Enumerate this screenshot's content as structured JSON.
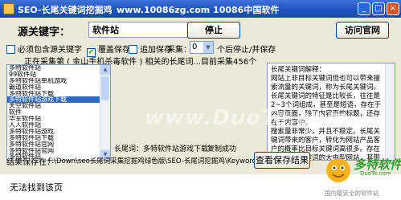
{
  "window": {
    "title": "SEO-长尾关键词挖掘鸡",
    "site_text": "www.10086zg.com  10086中国软件",
    "minimize_glyph": "_",
    "maximize_glyph": "□",
    "close_glyph": "×"
  },
  "form": {
    "keyword_label": "源关键字：",
    "keyword_value": "软件站",
    "stop_button": "停止",
    "home_button": "访问官网",
    "option_include": "必须包含源关键字",
    "option_overwrite": "覆盖保存",
    "option_append": "追加保存",
    "collect_label": "采集：",
    "collect_value": "0",
    "pause_text": "个后停止/并保存",
    "status_text": "正在采集第 ( 金山手机杀毒软件 ) 相关的长尾词...目前采集456个"
  },
  "results": {
    "items": [
      "多特软件站",
      "99软件站",
      "多特软件站单机游戏",
      "霸道软件站",
      "多特软件站下载",
      "多特软件站游戏下载",
      "天空软件站",
      "软件",
      "华军软件站",
      "人人软件站",
      "多特软件站游戏",
      "多特软件站下载",
      "多特软件站官网",
      "多特软件站官网",
      "多特软件站"
    ],
    "selected_index": 5,
    "longtail_label": "长尾词：多特软件站游戏下载",
    "copied_text": "复制成功"
  },
  "info": {
    "text": "长尾关键词解释：\n网站上非目标关键词但也可以带来搜索流量的关键词，称为长尾关键词。\n长尾关键词的特征是比较长，往往是2~3个词组成，甚至是短语，存在于内容页面，除了内容页的标题，还存在于内容中。\n搜索量非常少，并且不稳定。长尾关键词带来的客户，转化为网站产品客户的概率比目标关键词高很多。存在大量长尾关键词的大中型网站，其带来的总流量非常大。例如，长尾关键词特征表示全部关键词。"
  },
  "save": {
    "label": "结果保存在：",
    "path": "F:\\Down\\seo长尾词采集挖掘鸡绿色版\\SEO-长尾词挖掘鸡\\Keywords\\",
    "view_button": "查看保存结果"
  },
  "page": {
    "bottom_text": "无法找到该页"
  },
  "watermark": {
    "text": "www.DuoTe.com"
  },
  "brand": {
    "name": "多特软件站",
    "sub": "DuoTe.com",
    "slogan": "国内最安全的软件站"
  }
}
